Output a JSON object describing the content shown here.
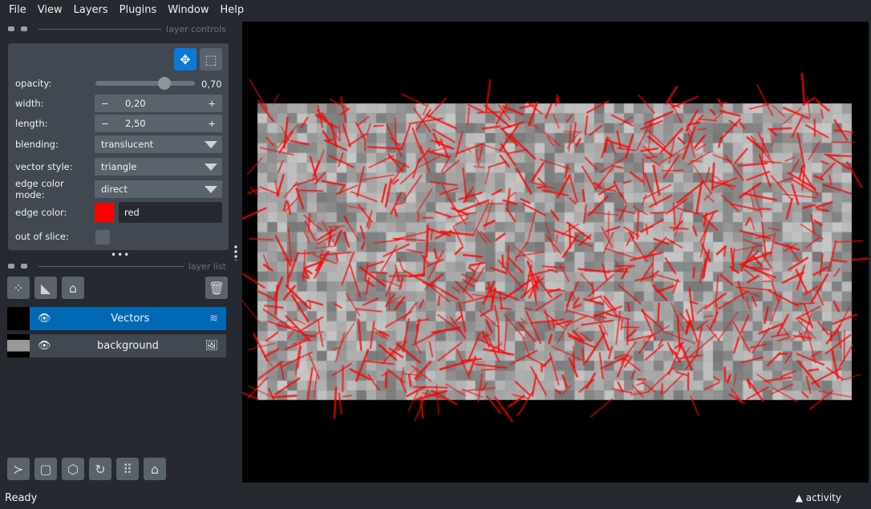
{
  "menu": [
    "File",
    "View",
    "Layers",
    "Plugins",
    "Window",
    "Help"
  ],
  "layer_controls": {
    "title": "layer controls",
    "opacity": {
      "label": "opacity:",
      "value": "0,70",
      "fraction": 0.7
    },
    "width": {
      "label": "width:",
      "value": "0,20"
    },
    "length": {
      "label": "length:",
      "value": "2,50"
    },
    "blending": {
      "label": "blending:",
      "value": "translucent"
    },
    "vector_style": {
      "label": "vector style:",
      "value": "triangle"
    },
    "edge_color_mode": {
      "label": "edge color mode:",
      "value": "direct"
    },
    "edge_color": {
      "label": "edge color:",
      "value": "red",
      "swatch": "#ff0000"
    },
    "out_of_slice": {
      "label": "out of slice:"
    }
  },
  "layer_list": {
    "title": "layer list",
    "layers": [
      {
        "name": "Vectors",
        "selected": true
      },
      {
        "name": "background",
        "selected": false
      }
    ]
  },
  "colors": {
    "accent": "#0069b4",
    "vector": "#ff0000"
  },
  "status": {
    "text": "Ready",
    "activity": "▲ activity"
  }
}
